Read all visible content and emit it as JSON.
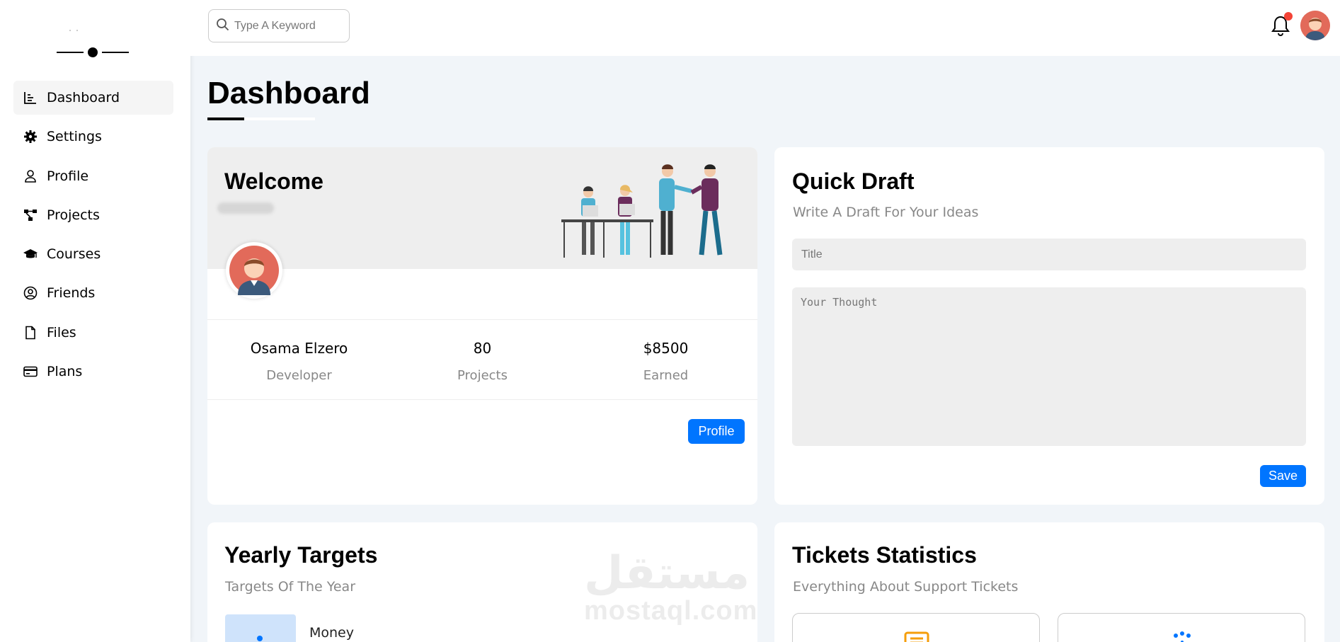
{
  "sidebar": {
    "items": [
      {
        "label": "Dashboard",
        "icon": "chart-line-icon",
        "active": true
      },
      {
        "label": "Settings",
        "icon": "gear-icon"
      },
      {
        "label": "Profile",
        "icon": "user-icon"
      },
      {
        "label": "Projects",
        "icon": "diagram-project-icon"
      },
      {
        "label": "Courses",
        "icon": "graduation-cap-icon"
      },
      {
        "label": "Friends",
        "icon": "circle-user-icon"
      },
      {
        "label": "Files",
        "icon": "file-icon"
      },
      {
        "label": "Plans",
        "icon": "credit-card-icon"
      }
    ]
  },
  "header": {
    "search_placeholder": "Type A Keyword"
  },
  "page": {
    "title": "Dashboard"
  },
  "welcome": {
    "title": "Welcome",
    "stats": [
      {
        "value": "Osama Elzero",
        "label": "Developer"
      },
      {
        "value": "80",
        "label": "Projects"
      },
      {
        "value": "$8500",
        "label": "Earned"
      }
    ],
    "button_label": "Profile"
  },
  "draft": {
    "title": "Quick Draft",
    "subtitle": "Write A Draft For Your Ideas",
    "title_placeholder": "Title",
    "thought_placeholder": "Your Thought",
    "save_label": "Save"
  },
  "yearly": {
    "title": "Yearly Targets",
    "subtitle": "Targets Of The Year",
    "money_label": "Money"
  },
  "tickets": {
    "title": "Tickets Statistics",
    "subtitle": "Everything About Support Tickets"
  },
  "watermark": {
    "arabic": "مستقل",
    "latin": "mostaql.com"
  },
  "colors": {
    "accent": "#0075ff",
    "badge": "#f44336",
    "page_bg": "#f1f5f9"
  }
}
